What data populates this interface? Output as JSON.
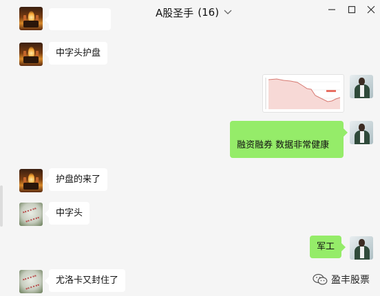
{
  "window": {
    "title": "A股圣手",
    "member_count": "(16)"
  },
  "messages": [
    {
      "side": "left",
      "avatar": "fire-avatar",
      "text": "中字头护盘"
    },
    {
      "side": "right",
      "avatar": "man-avatar",
      "type": "image"
    },
    {
      "side": "right",
      "avatar": "man-avatar",
      "text": "融资融券 数据非常健康"
    },
    {
      "side": "left",
      "avatar": "fire-avatar",
      "text": "护盘的来了"
    },
    {
      "side": "left",
      "avatar": "stone-avatar",
      "text": "中字头"
    },
    {
      "side": "right",
      "avatar": "man-avatar",
      "text": "军工"
    },
    {
      "side": "left",
      "avatar": "stone-avatar",
      "text": "尤洛卡又封住了"
    }
  ],
  "watermark": {
    "text": "盈丰股票"
  },
  "colors": {
    "outgoing_bubble": "#95ec69",
    "incoming_bubble": "#ffffff",
    "background": "#f5f5f5"
  }
}
